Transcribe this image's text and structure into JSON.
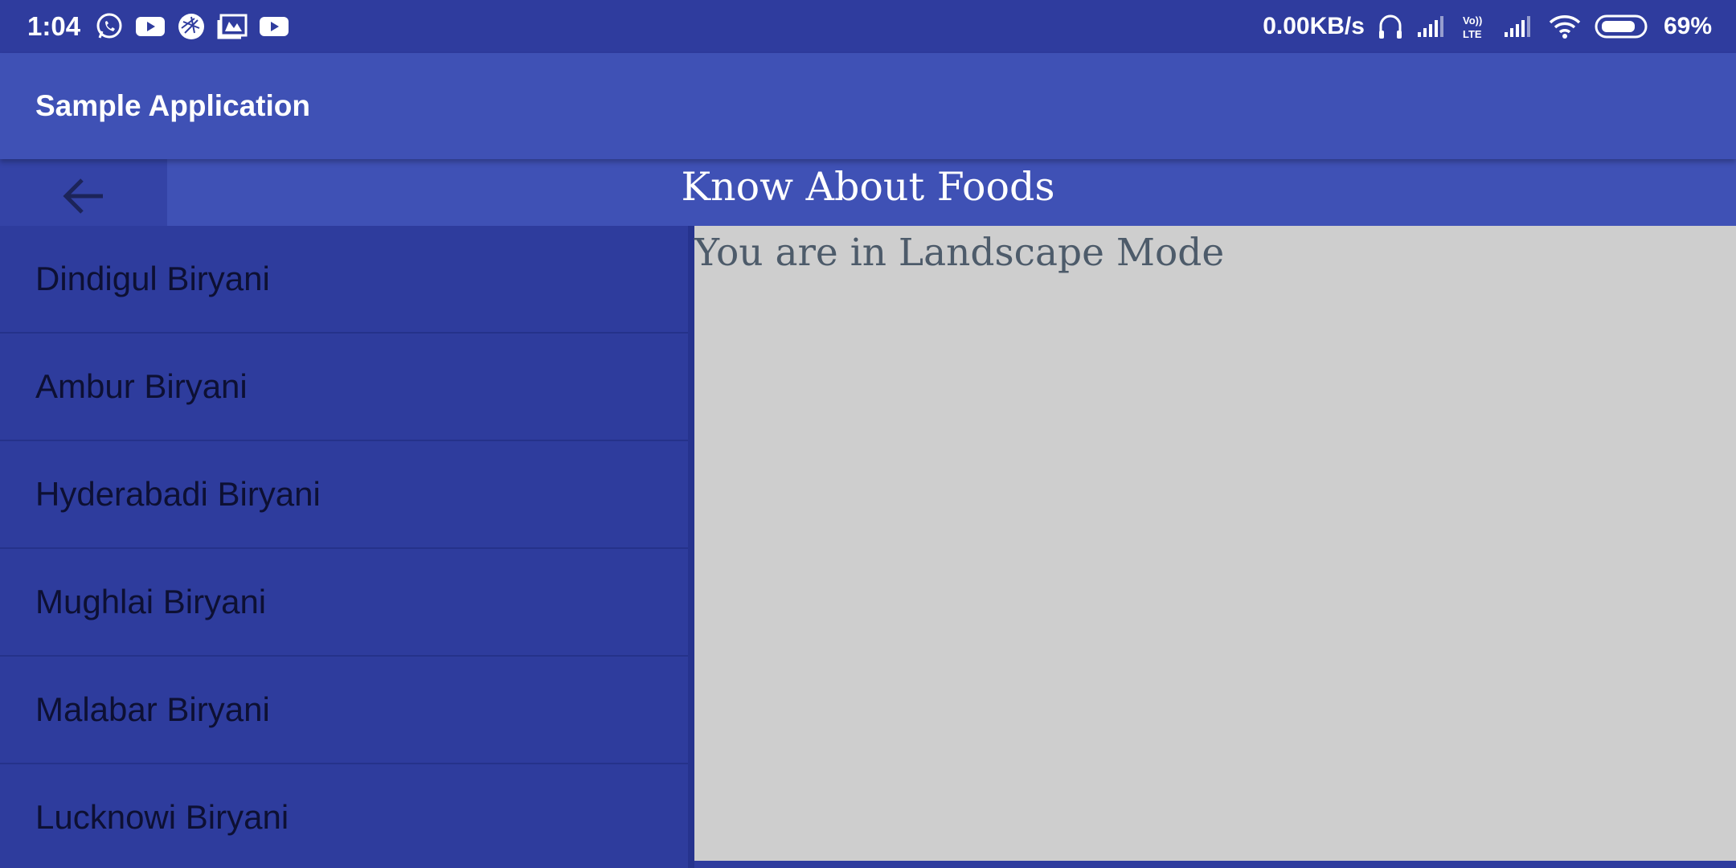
{
  "status_bar": {
    "time": "1:04",
    "left_icons": [
      "whatsapp-icon",
      "youtube-icon",
      "aperture-icon",
      "gallery-icon",
      "youtube-icon"
    ],
    "net_speed": "0.00KB/s",
    "battery_percent": "69%",
    "volte": "Vo)) LTE"
  },
  "app_bar": {
    "title": "Sample Application"
  },
  "header": {
    "title": "Know About Foods"
  },
  "food_list": [
    "Dindigul Biryani",
    "Ambur Biryani",
    "Hyderabadi Biryani",
    "Mughlai Biryani",
    "Malabar Biryani",
    "Lucknowi Biryani"
  ],
  "detail": {
    "message": "You are in Landscape Mode"
  },
  "colors": {
    "primary": "#3f51b5",
    "primary_dark": "#2f3c9e",
    "list_bg": "#2e3c9d",
    "detail_bg": "#cecece",
    "detail_text": "#4d5b6a"
  }
}
